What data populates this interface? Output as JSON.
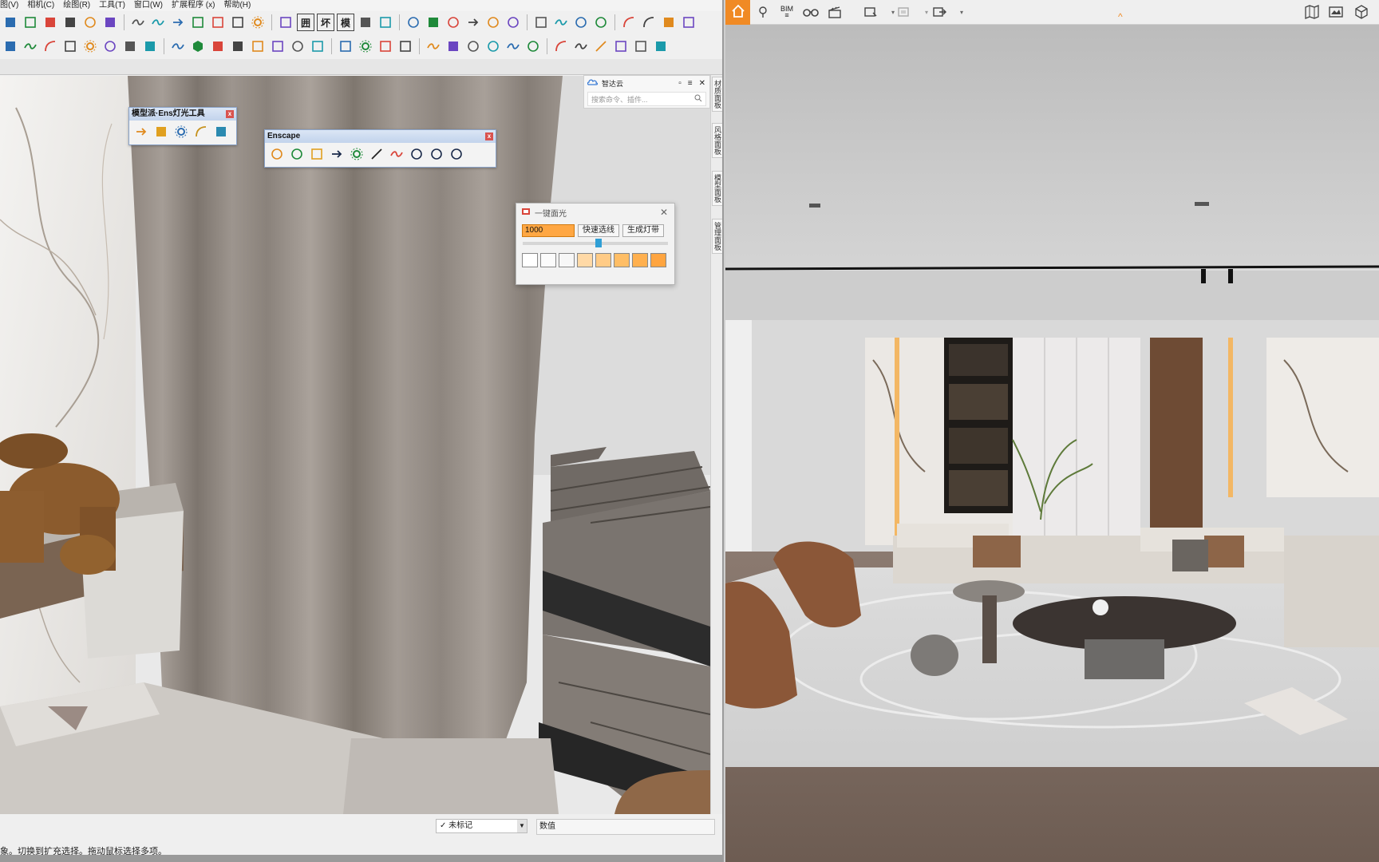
{
  "menu": [
    "图(V)",
    "相机(C)",
    "绘图(R)",
    "工具(T)",
    "窗口(W)",
    "扩展程序 (x)",
    "帮助(H)"
  ],
  "colors": {
    "accent_orange": "#f08a24",
    "lumen_field": "#ffa743",
    "slider_knob": "#2f9fd6",
    "title_blue": "#c2d3ec"
  },
  "toolbar_row1_icons": [
    "select-icon",
    "paint-icon",
    "eraser-icon",
    "folder-icon",
    "save-icon",
    "camera-icon",
    "box-icon",
    "arrow-select-icon",
    "component-icon",
    "group-icon",
    "cloud-icon",
    "lasso-icon",
    "fullscreen-icon",
    "table-icon",
    "layout-icon",
    "model-icon",
    "move-icon",
    "rotate-icon",
    "line-icon",
    "rect-fill-icon",
    "copy-icon",
    "undo-icon",
    "orbit-icon",
    "pan-icon",
    "hand-icon",
    "door-icon",
    "settings-icon",
    "gear-red-icon",
    "window-icon",
    "chart-icon"
  ],
  "toolbar_row1_text": {
    "b1": "囲",
    "b2": "坏",
    "b3": "模"
  },
  "toolbar_row2_icons": [
    "circle-icon",
    "arc-icon",
    "polyline-icon",
    "curve-icon",
    "big-circle-icon",
    "push-icon",
    "offset-icon",
    "follow-icon",
    "pen-icon",
    "rotate-tool-icon",
    "spiral-icon",
    "bezier-icon",
    "swirl-icon",
    "plant-icon",
    "arch-icon",
    "arrow-icon",
    "align-icon",
    "distribute-icon",
    "stack-icon",
    "level-icon",
    "paint-bucket-icon",
    "shield-icon",
    "lock-icon",
    "leaf-icon",
    "hex-icon",
    "cube-icon",
    "material-icon",
    "map-icon",
    "texture-icon",
    "brush-icon",
    "door2-icon",
    "pencil-icon"
  ],
  "tab": "",
  "floating_toolbars": {
    "ens_lights": {
      "title": "模型派·Ens灯光工具",
      "icons": [
        "spotlight-icon",
        "wrench-icon",
        "move-light-icon",
        "mountain-icon",
        "person-icon"
      ]
    },
    "enscape": {
      "title": "Enscape",
      "icons": [
        "enscape-start-icon",
        "sync-icon",
        "video-icon",
        "add-asset-icon",
        "tree-asset-icon",
        "material-checker-icon",
        "upload-cloud-icon",
        "settings-gear-icon",
        "feedback-mail-icon",
        "info-icon"
      ]
    }
  },
  "cloud_panel": {
    "title": "智达云",
    "search_placeholder": "搜索命令、插件..."
  },
  "side_tabs": [
    "材质面板",
    "风格面板",
    "模型面板",
    "管理面板"
  ],
  "light_dialog": {
    "title": "一键面光",
    "lumen_value": "1000",
    "btn_quick": "快速选线",
    "btn_generate": "生成灯带",
    "slider_fraction": 0.5,
    "swatches": [
      "#ffffff",
      "#fbfbfb",
      "#f7f7f7",
      "#ffd9a6",
      "#ffcb86",
      "#ffbe66",
      "#ffb04f",
      "#ffa540"
    ]
  },
  "status": {
    "tag_label": "✓ 未标记",
    "measure_label": "数值",
    "hint": "象。切换到扩充选择。拖动鼠标选择多项。"
  },
  "render_toolbar": {
    "icons": [
      "home-icon",
      "location-pin-icon",
      "bim-icon",
      "binoculars-icon",
      "clapper-icon",
      "screenshot-icon",
      "batch-render-icon",
      "export-icon",
      "map-book-icon",
      "panorama-icon",
      "cube-view-icon"
    ],
    "bim_label": "BIM",
    "caret": "^"
  }
}
